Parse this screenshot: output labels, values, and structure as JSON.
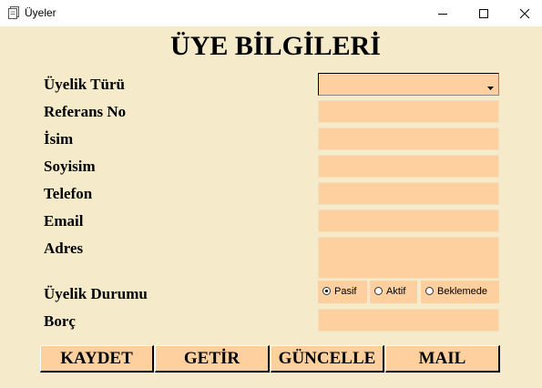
{
  "window": {
    "title": "Üyeler",
    "minimize_icon": "minimize-icon",
    "maximize_icon": "maximize-icon",
    "close_icon": "close-icon"
  },
  "form": {
    "heading": "ÜYE BİLGİLERİ",
    "labels": {
      "uyelik_turu": "Üyelik Türü",
      "referans_no": "Referans No",
      "isim": "İsim",
      "soyisim": "Soyisim",
      "telefon": "Telefon",
      "email": "Email",
      "adres": "Adres",
      "uyelik_durumu": "Üyelik Durumu",
      "borc": "Borç"
    },
    "values": {
      "uyelik_turu": "",
      "referans_no": "",
      "isim": "",
      "soyisim": "",
      "telefon": "",
      "email": "",
      "adres": "",
      "borc": ""
    },
    "status_options": [
      {
        "label": "Pasif",
        "checked": true
      },
      {
        "label": "Aktif",
        "checked": false
      },
      {
        "label": "Beklemede",
        "checked": false
      }
    ]
  },
  "buttons": {
    "save": "KAYDET",
    "fetch": "GETİR",
    "update": "GÜNCELLE",
    "mail": "MAIL"
  },
  "colors": {
    "background": "#f5ebcb",
    "field": "#fecf9f"
  }
}
